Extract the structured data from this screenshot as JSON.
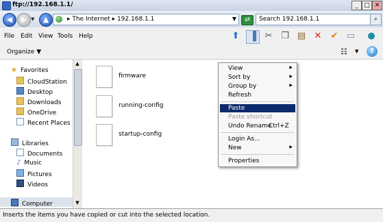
{
  "window": {
    "title": "ftp://192.168.1.1/"
  },
  "address": {
    "path": "▸ The Internet ▸ 192.168.1.1"
  },
  "search": {
    "placeholder": "Search 192.168.1.1"
  },
  "menubar": {
    "items": [
      "File",
      "Edit",
      "View",
      "Tools",
      "Help"
    ]
  },
  "command_bar": {
    "organize_label": "Organize"
  },
  "nav_pane": {
    "favorites_label": "Favorites",
    "favorites": [
      "CloudStation",
      "Desktop",
      "Downloads",
      "OneDrive",
      "Recent Places"
    ],
    "libraries_label": "Libraries",
    "libraries": [
      "Documents",
      "Music",
      "Pictures",
      "Videos"
    ],
    "computer_label": "Computer"
  },
  "files": [
    {
      "name": "firmware"
    },
    {
      "name": "running-config"
    },
    {
      "name": "startup-config"
    }
  ],
  "context_menu": {
    "items": [
      {
        "label": "View",
        "submenu": true
      },
      {
        "label": "Sort by",
        "submenu": true
      },
      {
        "label": "Group by",
        "submenu": true
      },
      {
        "label": "Refresh"
      },
      {
        "label": "Paste",
        "active": true
      },
      {
        "label": "Paste shortcut",
        "disabled": true
      },
      {
        "label": "Undo Rename",
        "shortcut": "Ctrl+Z"
      },
      {
        "label": "Login As..."
      },
      {
        "label": "New",
        "submenu": true
      },
      {
        "label": "Properties"
      }
    ]
  },
  "status_bar": {
    "text": "Inserts the items you have copied or cut into the selected location."
  }
}
